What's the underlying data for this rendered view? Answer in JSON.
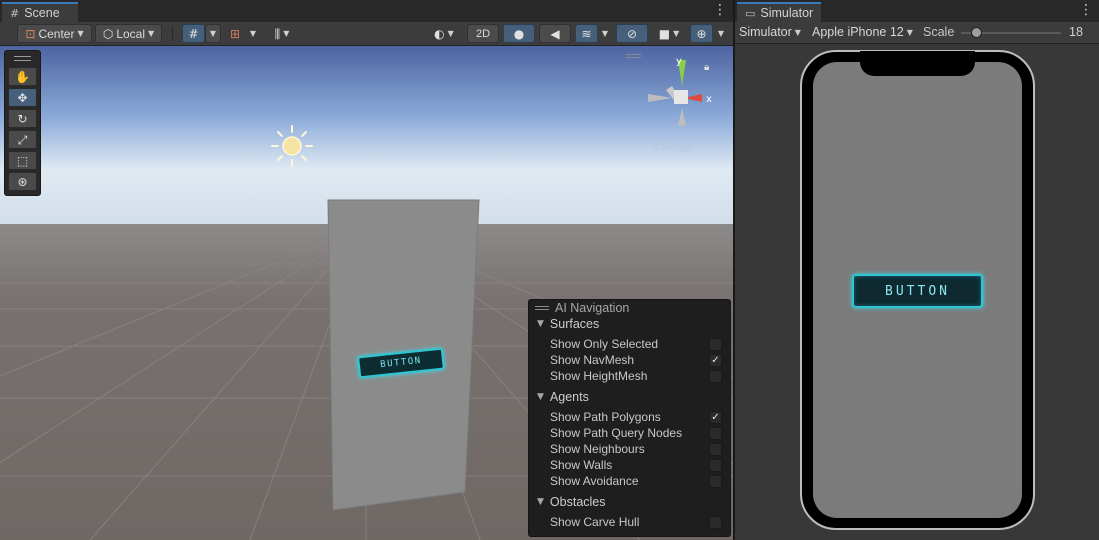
{
  "scene": {
    "tab_label": "Scene",
    "tab_icon": "grid-icon",
    "toolbar": {
      "pivot_label": "Center",
      "space_label": "Local",
      "mode_2d_label": "2D"
    },
    "persp_label": "< Persp",
    "gizmo": {
      "y_label": "y",
      "x_label": "x"
    },
    "world_button_text": "BUTTON"
  },
  "ai_navigation": {
    "title": "AI Navigation",
    "sections": [
      {
        "title": "Surfaces",
        "options": [
          {
            "label": "Show Only Selected",
            "checked": false
          },
          {
            "label": "Show NavMesh",
            "checked": true
          },
          {
            "label": "Show HeightMesh",
            "checked": false
          }
        ]
      },
      {
        "title": "Agents",
        "options": [
          {
            "label": "Show Path Polygons",
            "checked": true
          },
          {
            "label": "Show Path Query Nodes",
            "checked": false
          },
          {
            "label": "Show Neighbours",
            "checked": false
          },
          {
            "label": "Show Walls",
            "checked": false
          },
          {
            "label": "Show Avoidance",
            "checked": false
          }
        ]
      },
      {
        "title": "Obstacles",
        "options": [
          {
            "label": "Show Carve Hull",
            "checked": false
          }
        ]
      }
    ]
  },
  "simulator": {
    "tab_label": "Simulator",
    "mode_label": "Simulator",
    "device_label": "Apple iPhone 12",
    "scale_label": "Scale",
    "scale_value": "18",
    "ui_button_text": "BUTTON"
  },
  "colors": {
    "accent": "#3a79bb",
    "panel_bg": "#383838",
    "button_glow": "#2fc6d3"
  }
}
